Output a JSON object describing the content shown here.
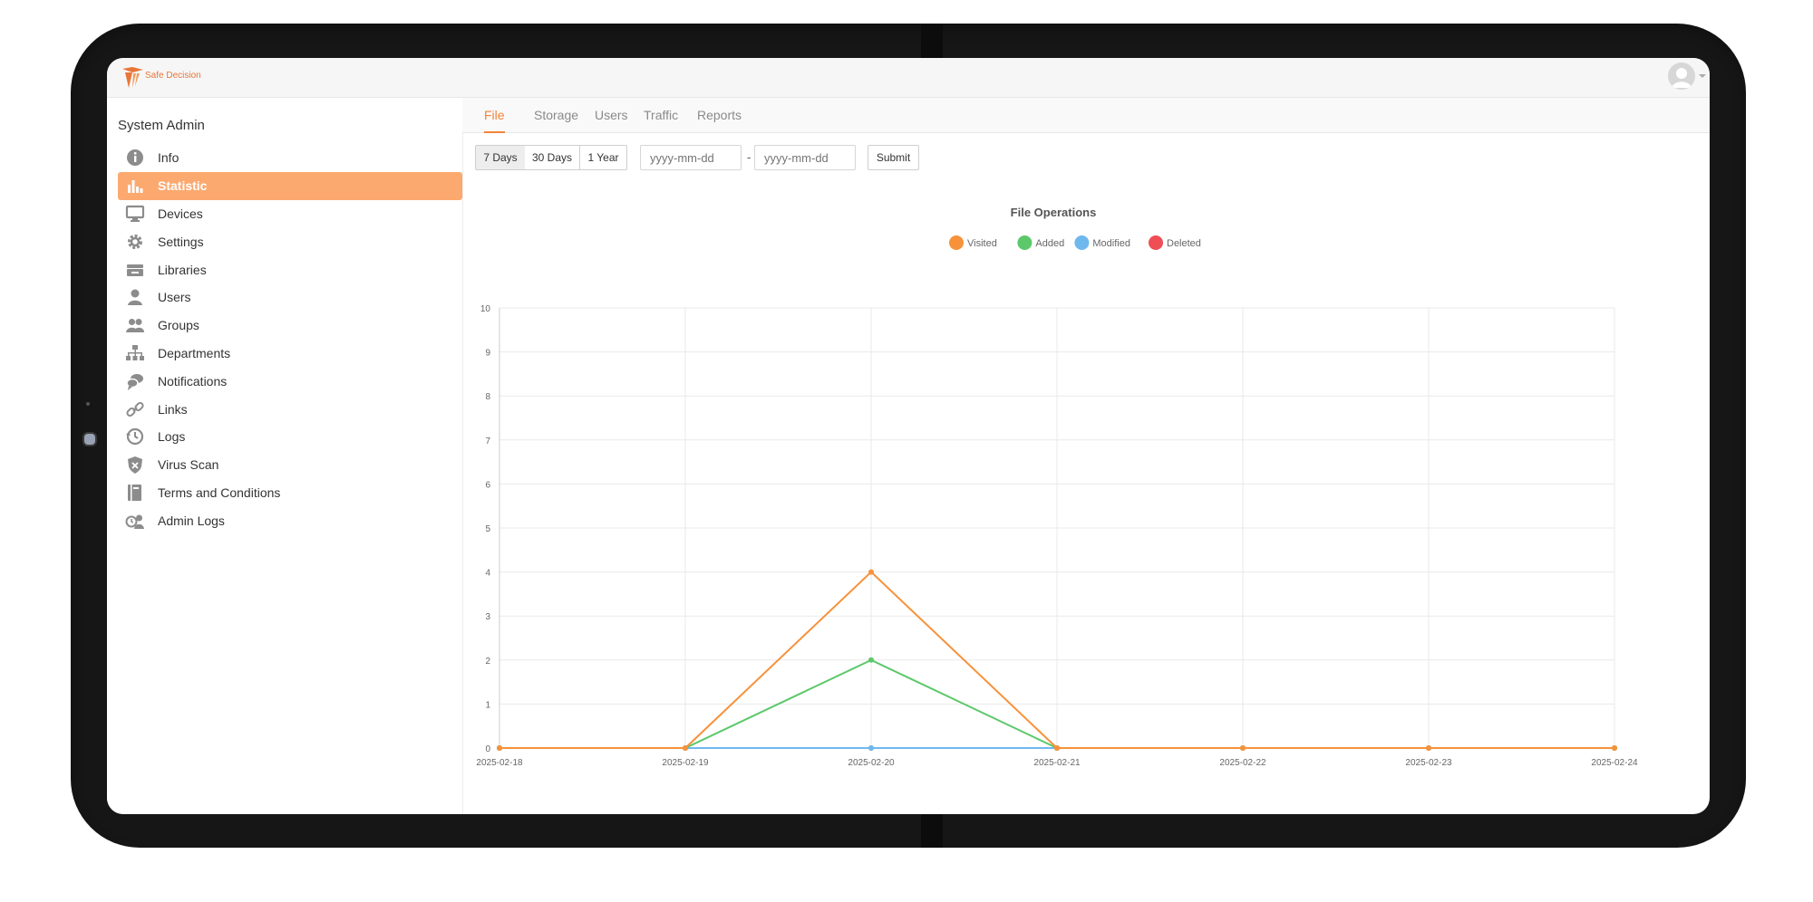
{
  "header": {
    "logo_text": "Safe Decision"
  },
  "sidebar": {
    "title": "System Admin",
    "items": [
      {
        "label": "Info",
        "icon": "info-icon"
      },
      {
        "label": "Statistic",
        "icon": "bar-chart-icon",
        "active": true
      },
      {
        "label": "Devices",
        "icon": "monitor-icon"
      },
      {
        "label": "Settings",
        "icon": "gear-icon"
      },
      {
        "label": "Libraries",
        "icon": "library-icon"
      },
      {
        "label": "Users",
        "icon": "user-icon"
      },
      {
        "label": "Groups",
        "icon": "group-icon"
      },
      {
        "label": "Departments",
        "icon": "org-chart-icon"
      },
      {
        "label": "Notifications",
        "icon": "chat-bubbles-icon"
      },
      {
        "label": "Links",
        "icon": "link-icon"
      },
      {
        "label": "Logs",
        "icon": "history-icon"
      },
      {
        "label": "Virus Scan",
        "icon": "shield-x-icon"
      },
      {
        "label": "Terms and Conditions",
        "icon": "book-icon"
      },
      {
        "label": "Admin Logs",
        "icon": "admin-history-icon"
      }
    ]
  },
  "tabs": [
    "File",
    "Storage",
    "Users",
    "Traffic",
    "Reports"
  ],
  "active_tab": "File",
  "toolbar": {
    "ranges": [
      "7 Days",
      "30 Days",
      "1 Year"
    ],
    "active_range": "7 Days",
    "start_placeholder": "yyyy-mm-dd",
    "end_placeholder": "yyyy-mm-dd",
    "separator": "-",
    "submit_label": "Submit"
  },
  "colors": {
    "accent": "#f0843c",
    "active_nav": "#fca96f"
  },
  "chart_data": {
    "type": "line",
    "title": "File Operations",
    "x": [
      "2025-02-18",
      "2025-02-19",
      "2025-02-20",
      "2025-02-21",
      "2025-02-22",
      "2025-02-23",
      "2025-02-24"
    ],
    "ylim": [
      0,
      10
    ],
    "yticks": [
      0,
      1,
      2,
      3,
      4,
      5,
      6,
      7,
      8,
      9,
      10
    ],
    "grid": true,
    "legend": "top",
    "series": [
      {
        "name": "Visited",
        "color": "#f7923b",
        "values": [
          0,
          0,
          4,
          0,
          0,
          0,
          0
        ]
      },
      {
        "name": "Added",
        "color": "#5cc86a",
        "values": [
          0,
          0,
          2,
          0,
          0,
          0,
          0
        ]
      },
      {
        "name": "Modified",
        "color": "#6fb8ee",
        "values": [
          0,
          0,
          0,
          0,
          0,
          0,
          0
        ]
      },
      {
        "name": "Deleted",
        "color": "#ef4e55",
        "values": [
          0,
          0,
          0,
          0,
          0,
          0,
          0
        ]
      }
    ]
  }
}
